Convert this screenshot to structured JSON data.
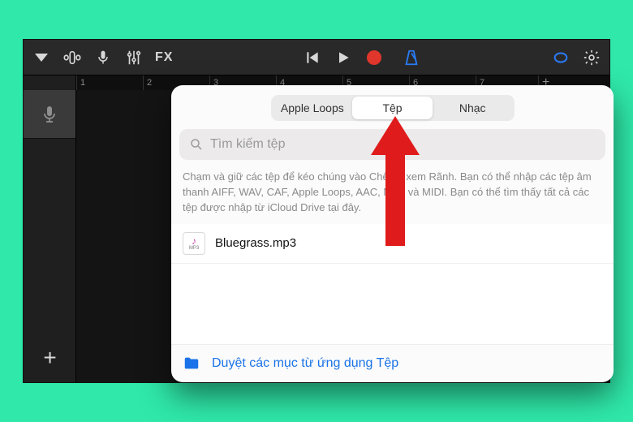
{
  "toolbar": {
    "fx_label": "FX"
  },
  "ruler": {
    "marks": [
      "1",
      "2",
      "3",
      "4",
      "5",
      "6",
      "7"
    ]
  },
  "popover": {
    "tabs": {
      "apple_loops": "Apple Loops",
      "files": "Tệp",
      "music": "Nhạc"
    },
    "search_placeholder": "Tìm kiếm tệp",
    "hint": "Chạm và giữ các tệp để kéo chúng vào Chế độ xem Rãnh. Bạn có thể nhập các tệp âm thanh AIFF, WAV, CAF, Apple Loops, AAC, MP3 và MIDI. Bạn có thể tìm thấy tất cả các tệp được nhập từ iCloud Drive tại đây.",
    "browse_label": "Duyệt các mục từ ứng dụng Tệp",
    "files_list": [
      {
        "name": "Bluegrass.mp3",
        "ext": "MP3"
      }
    ]
  }
}
